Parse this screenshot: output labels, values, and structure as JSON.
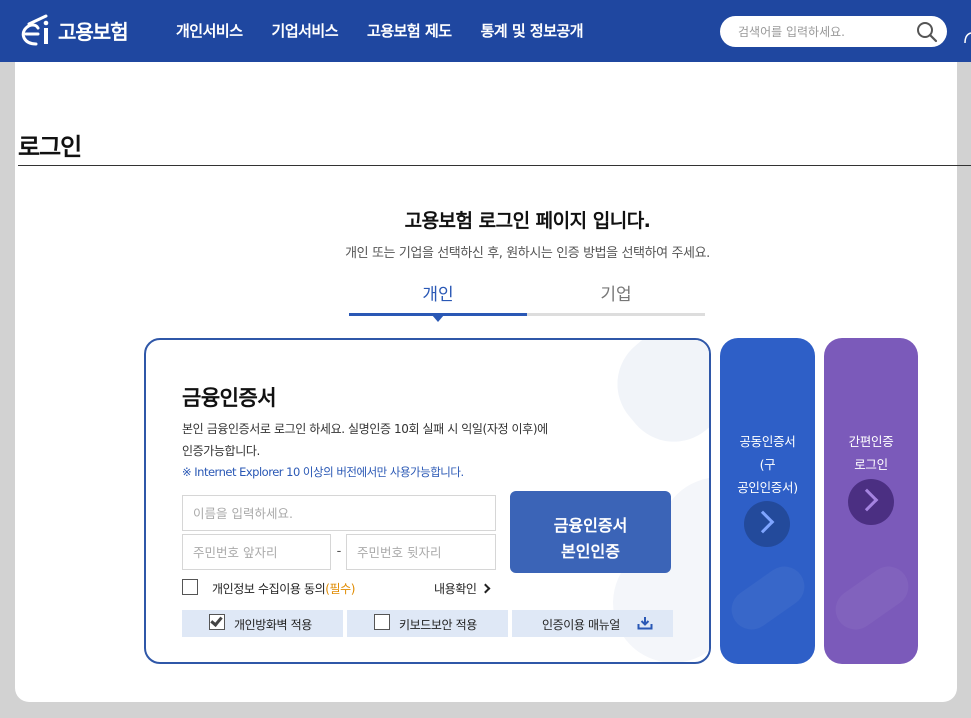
{
  "header": {
    "logo_text": "고용보험",
    "nav": [
      "개인서비스",
      "기업서비스",
      "고용보험 제도",
      "통계 및 정보공개"
    ],
    "search_placeholder": "검색어를 입력하세요."
  },
  "page": {
    "title": "로그인",
    "heading": "고용보험 로그인 페이지 입니다.",
    "subheading": "개인 또는 기업을 선택하신 후, 원하시는 인증 방법을 선택하여 주세요."
  },
  "tabs": {
    "personal": "개인",
    "company": "기업",
    "active": "personal"
  },
  "card": {
    "title": "금융인증서",
    "desc_line1": "본인 금융인증서로 로그인 하세요. 실명인증 10회 실패 시 익일(자정 이후)에",
    "desc_line2": "인증가능합니다.",
    "note": "※ Internet Explorer 10 이상의 버전에서만 사용가능합니다.",
    "name_placeholder": "이름을 입력하세요.",
    "rrn_front_placeholder": "주민번호 앞자리",
    "rrn_separator": "-",
    "rrn_back_placeholder": "주민번호 뒷자리",
    "button_line1": "금융인증서",
    "button_line2": "본인인증",
    "agree_label": "개인정보 수집이용 동의",
    "agree_required": "(필수)",
    "view_link": "내용확인",
    "opt_firewall": "개인방화벽 적용",
    "opt_firewall_checked": true,
    "opt_keyboard": "키보드보안 적용",
    "opt_keyboard_checked": false,
    "opt_manual": "인증이용 매뉴얼"
  },
  "side": {
    "joint_line1": "공동인증서",
    "joint_line2": "(구",
    "joint_line3": "공인인증서)",
    "simple_line1": "간편인증",
    "simple_line2": "로그인"
  },
  "colors": {
    "header_bg": "#1f47a0",
    "accent": "#2a58b5",
    "cert_button": "#3b64b7",
    "joint_panel": "#2e5fc7",
    "simple_panel": "#7b5aba",
    "required": "#e08b00"
  }
}
